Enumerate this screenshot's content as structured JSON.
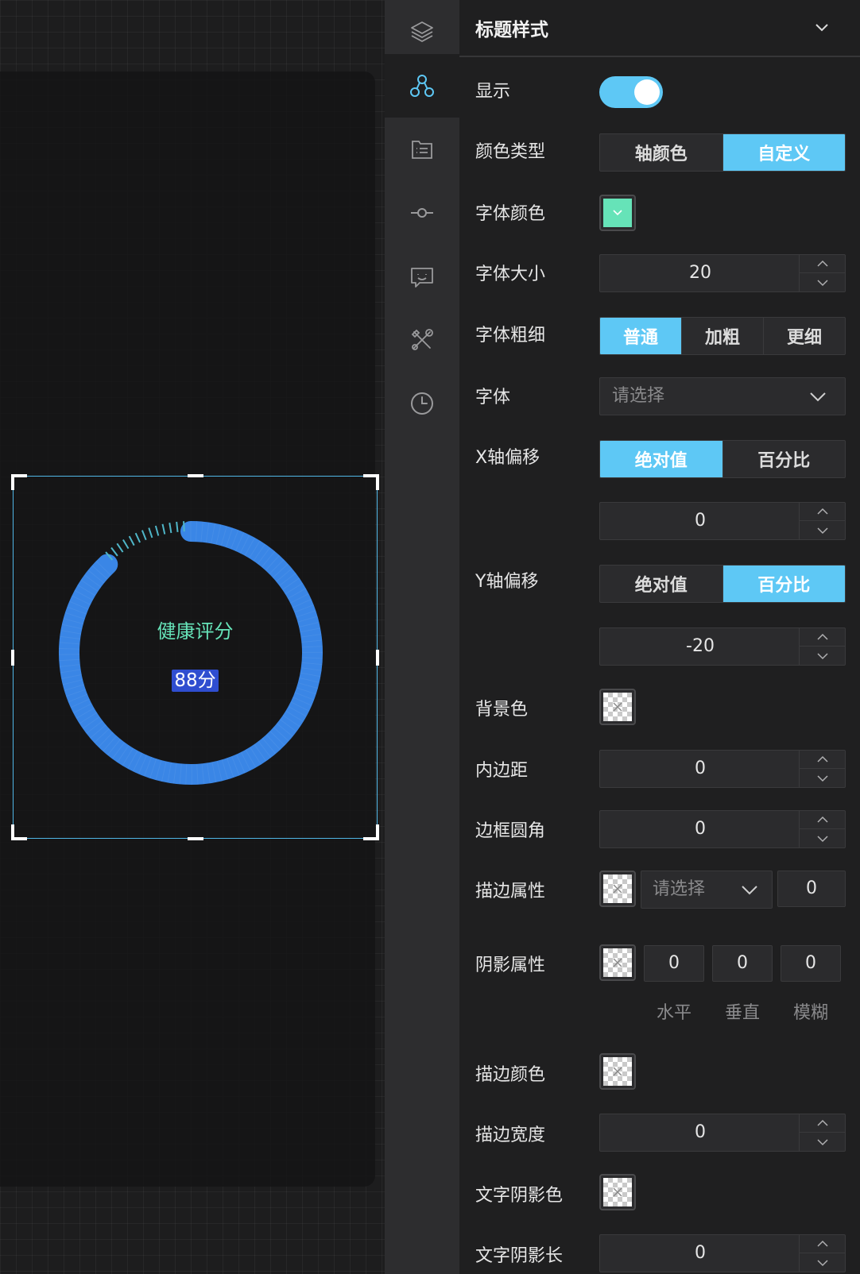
{
  "canvas": {
    "widget": {
      "title": "健康评分",
      "score": "88分",
      "title_color": "#66e3b8",
      "ring_color": "#3a86e6",
      "tick_color": "#4fb6c8",
      "score_badge_color": "#2f4ed0",
      "progress": 0.88
    }
  },
  "rail": {
    "items": [
      {
        "icon": "layers-icon"
      },
      {
        "icon": "nodes-icon",
        "active": true
      },
      {
        "icon": "list-document-icon"
      },
      {
        "icon": "commit-node-icon"
      },
      {
        "icon": "chat-bot-icon"
      },
      {
        "icon": "tools-icon"
      },
      {
        "icon": "clock-icon"
      }
    ]
  },
  "panel": {
    "title": "标题样式",
    "accent_color": "#5ec8f5",
    "rows": {
      "show": {
        "label": "显示",
        "on": true
      },
      "color_type": {
        "label": "颜色类型",
        "options": [
          "轴颜色",
          "自定义"
        ],
        "selected": 1
      },
      "font_color": {
        "label": "字体颜色",
        "color": "#66e3b8"
      },
      "font_size": {
        "label": "字体大小",
        "value": "20"
      },
      "font_weight": {
        "label": "字体粗细",
        "options": [
          "普通",
          "加粗",
          "更细"
        ],
        "selected": 0
      },
      "font_family": {
        "label": "字体",
        "placeholder": "请选择"
      },
      "x_offset": {
        "label": "X轴偏移",
        "options": [
          "绝对值",
          "百分比"
        ],
        "selected": 0,
        "value": "0"
      },
      "y_offset": {
        "label": "Y轴偏移",
        "options": [
          "绝对值",
          "百分比"
        ],
        "selected": 1,
        "value": "-20"
      },
      "background": {
        "label": "背景色"
      },
      "padding": {
        "label": "内边距",
        "value": "0"
      },
      "border_radius": {
        "label": "边框圆角",
        "value": "0"
      },
      "stroke": {
        "label": "描边属性",
        "placeholder": "请选择",
        "value": "0"
      },
      "shadow": {
        "label": "阴影属性",
        "h": "0",
        "v": "0",
        "blur": "0",
        "h_label": "水平",
        "v_label": "垂直",
        "blur_label": "模糊"
      },
      "stroke_color": {
        "label": "描边颜色"
      },
      "stroke_width": {
        "label": "描边宽度",
        "value": "0"
      },
      "text_shadow_color": {
        "label": "文字阴影色"
      },
      "text_shadow_len": {
        "label": "文字阴影长",
        "value": "0"
      }
    }
  }
}
